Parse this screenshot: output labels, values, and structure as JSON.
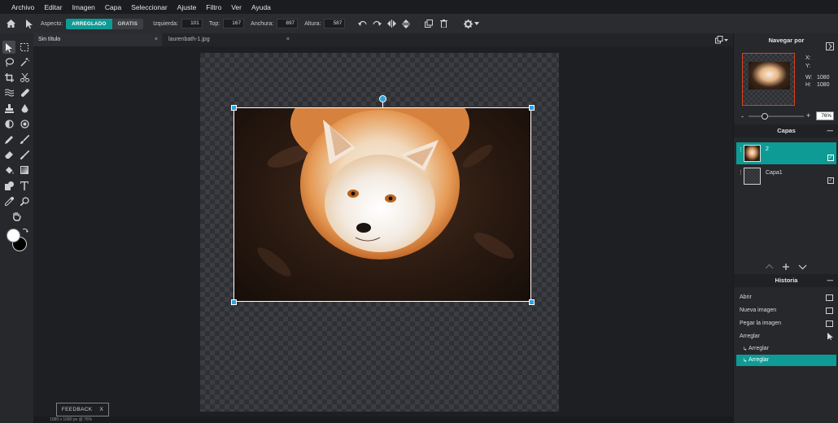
{
  "menu": [
    "Archivo",
    "Editar",
    "Imagen",
    "Capa",
    "Seleccionar",
    "Ajuste",
    "Filtro",
    "Ver",
    "Ayuda"
  ],
  "toolbar": {
    "aspect_label": "Aspecto:",
    "mode_on": "ARREGLADO",
    "mode_off": "GRATIS",
    "left_label": "Izquierda:",
    "left_value": "101",
    "top_label": "Top:",
    "top_value": "167",
    "width_label": "Anchura:",
    "width_value": "897",
    "height_label": "Altura:",
    "height_value": "587"
  },
  "tabs": [
    {
      "label": "Sin título",
      "close": "×"
    },
    {
      "label": "laurenbath-1.jpg",
      "close": "×"
    }
  ],
  "feedback": {
    "label": "FEEDBACK",
    "close": "X"
  },
  "status": "1080 x 1080 px @ 76%",
  "navigator": {
    "title": "Navegar por",
    "x_label": "X:",
    "y_label": "Y:",
    "w_label": "W:",
    "w_value": "1080",
    "h_label": "H:",
    "h_value": "1080",
    "zoom": "76%",
    "minus": "-",
    "plus": "+"
  },
  "layers": {
    "title": "Capas",
    "items": [
      {
        "name": "2",
        "selected": true
      },
      {
        "name": "Capa1",
        "selected": false
      }
    ]
  },
  "history": {
    "title": "Historia",
    "items": [
      "Abrir",
      "Nueva imagen",
      "Pegar la imagen",
      "Arreglar"
    ],
    "sub_items": [
      "Arreglar",
      "Arreglar"
    ]
  },
  "colors": {
    "accent": "#0e9b95",
    "handle": "#2fa2e0",
    "foreground": "#ffffff",
    "background": "#000000"
  }
}
